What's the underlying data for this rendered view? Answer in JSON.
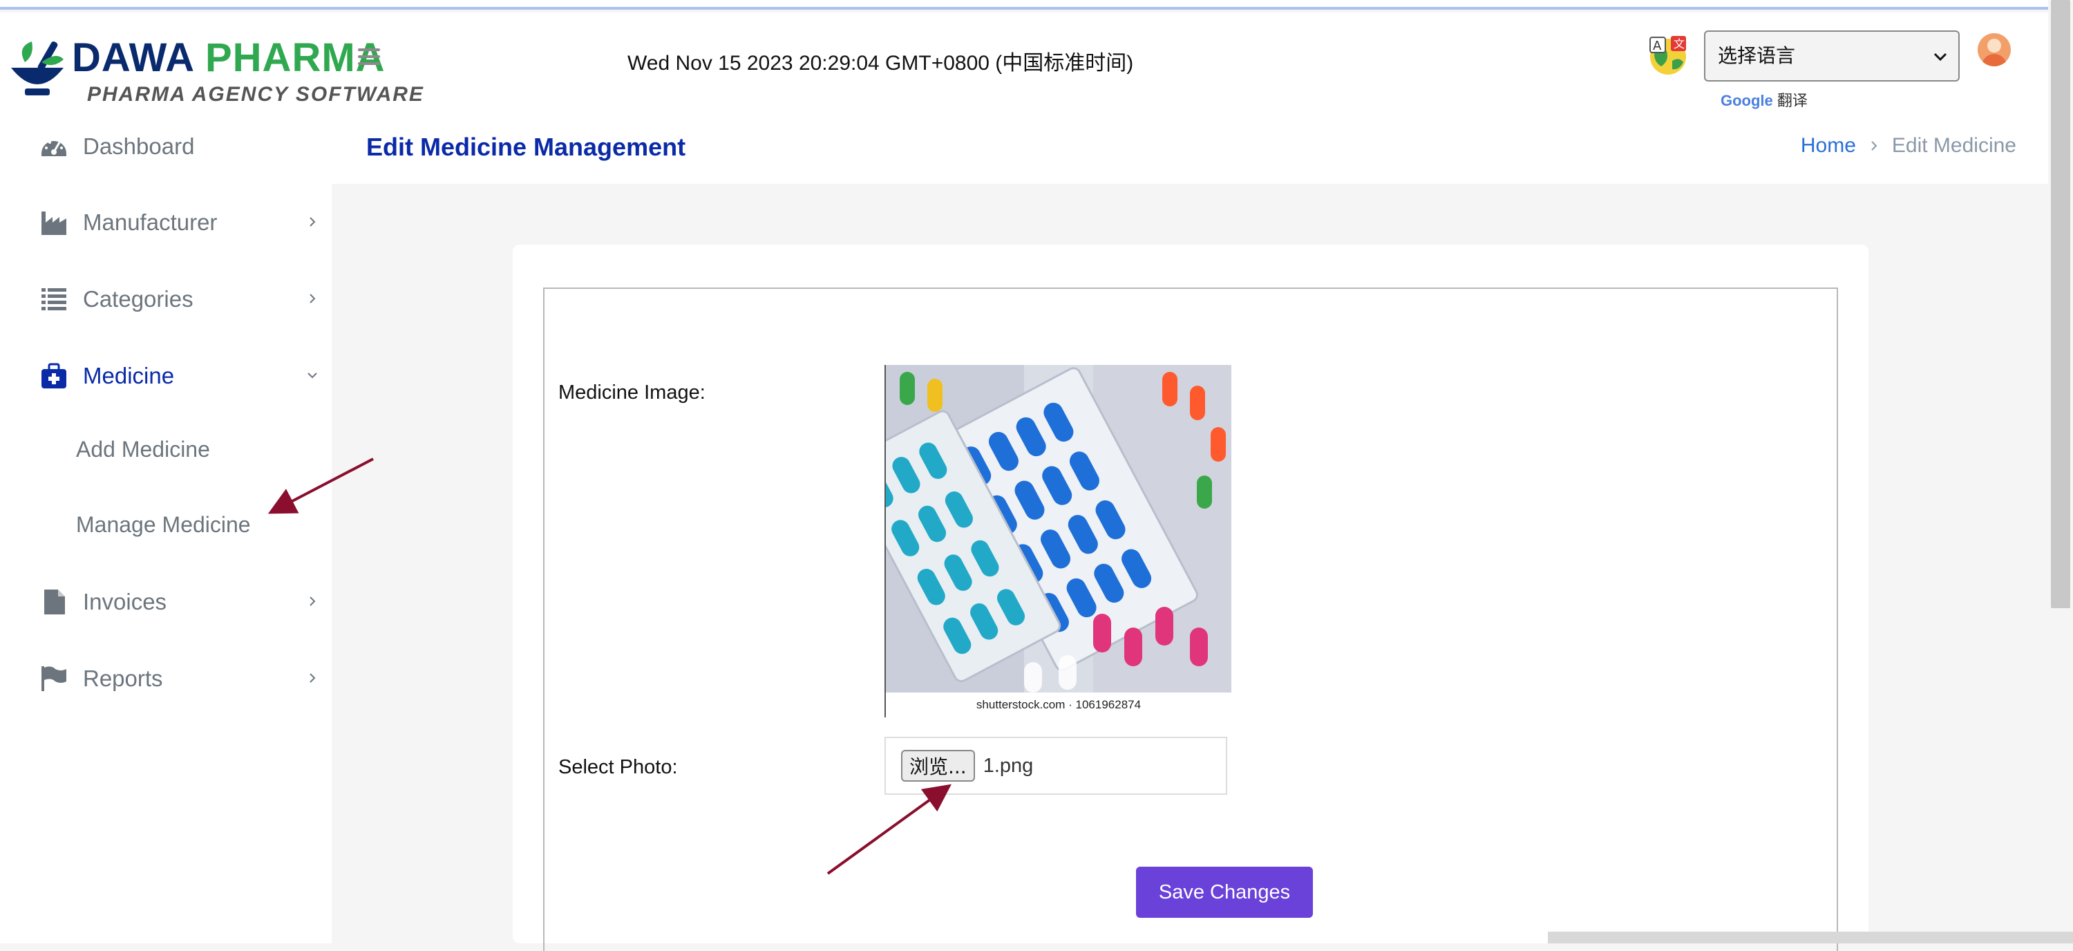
{
  "header": {
    "brand_primary": "DAWA",
    "brand_secondary": "PHARMA",
    "brand_tagline": "PHARMA AGENCY SOFTWARE",
    "clock_text": "Wed Nov 15 2023 20:29:04 GMT+0800 (中国标准时间)",
    "language_select_value": "选择语言",
    "google_label": "Google",
    "translate_label": "翻译",
    "colors": {
      "brand_navy": "#0a2a6e",
      "brand_green": "#2fa84f",
      "accent": "#0a2aa8"
    }
  },
  "sidebar": {
    "items": [
      {
        "label": "Dashboard",
        "icon": "dashboard-gauge-icon",
        "expandable": false
      },
      {
        "label": "Manufacturer",
        "icon": "factory-icon",
        "expandable": true
      },
      {
        "label": "Categories",
        "icon": "list-icon",
        "expandable": true
      },
      {
        "label": "Medicine",
        "icon": "medical-kit-icon",
        "expandable": true,
        "active": true,
        "children": [
          {
            "label": "Add Medicine"
          },
          {
            "label": "Manage Medicine"
          }
        ]
      },
      {
        "label": "Invoices",
        "icon": "file-icon",
        "expandable": true
      },
      {
        "label": "Reports",
        "icon": "flag-icon",
        "expandable": true
      }
    ]
  },
  "page": {
    "title": "Edit Medicine Management",
    "breadcrumb": {
      "home": "Home",
      "current": "Edit Medicine"
    }
  },
  "form": {
    "medicine_image_label": "Medicine Image:",
    "image_watermark": "shutterstock.com · 1061962874",
    "select_photo_label": "Select Photo:",
    "browse_button_label": "浏览...",
    "selected_file_name": "1.png",
    "save_button_label": "Save Changes",
    "save_button_color": "#6a41d9"
  }
}
